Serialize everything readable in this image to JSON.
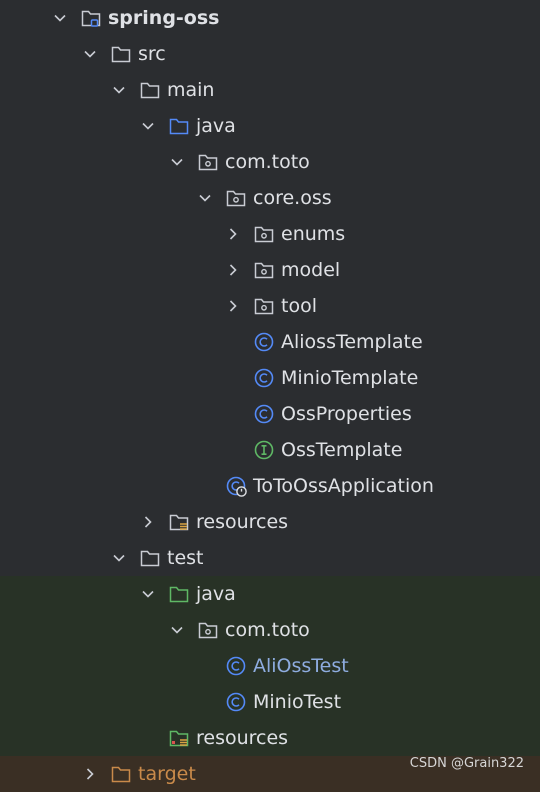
{
  "tree": {
    "items": [
      {
        "label": "spring-oss",
        "chevron": "down",
        "icon": "module-folder-icon"
      },
      {
        "label": "src",
        "chevron": "down",
        "icon": "folder-icon"
      },
      {
        "label": "main",
        "chevron": "down",
        "icon": "folder-icon"
      },
      {
        "label": "java",
        "chevron": "down",
        "icon": "source-folder-icon"
      },
      {
        "label": "com.toto",
        "chevron": "down",
        "icon": "package-icon"
      },
      {
        "label": "core.oss",
        "chevron": "down",
        "icon": "package-icon"
      },
      {
        "label": "enums",
        "chevron": "right",
        "icon": "package-icon"
      },
      {
        "label": "model",
        "chevron": "right",
        "icon": "package-icon"
      },
      {
        "label": "tool",
        "chevron": "right",
        "icon": "package-icon"
      },
      {
        "label": "AliossTemplate",
        "chevron": "none",
        "icon": "class-icon"
      },
      {
        "label": "MinioTemplate",
        "chevron": "none",
        "icon": "class-icon"
      },
      {
        "label": "OssProperties",
        "chevron": "none",
        "icon": "class-icon"
      },
      {
        "label": "OssTemplate",
        "chevron": "none",
        "icon": "interface-icon"
      },
      {
        "label": "ToToOssApplication",
        "chevron": "none",
        "icon": "spring-boot-class-icon"
      },
      {
        "label": "resources",
        "chevron": "right",
        "icon": "resources-folder-icon"
      },
      {
        "label": "test",
        "chevron": "down",
        "icon": "folder-icon"
      },
      {
        "label": "java",
        "chevron": "down",
        "icon": "test-source-folder-icon"
      },
      {
        "label": "com.toto",
        "chevron": "down",
        "icon": "package-icon"
      },
      {
        "label": "AliOssTest",
        "chevron": "none",
        "icon": "class-icon"
      },
      {
        "label": "MinioTest",
        "chevron": "none",
        "icon": "class-icon"
      },
      {
        "label": "resources",
        "chevron": "none",
        "icon": "test-resources-folder-icon"
      },
      {
        "label": "target",
        "chevron": "right",
        "icon": "excluded-folder-icon"
      }
    ]
  },
  "watermark": "CSDN @Grain322",
  "colors": {
    "background": "#2b2d30",
    "test_background": "#283226",
    "excluded_background": "#3a2f24",
    "class_icon": "#548af7",
    "interface_icon": "#5fb865",
    "excluded_text": "#c98a4a",
    "modified_text": "#8eacdf"
  }
}
